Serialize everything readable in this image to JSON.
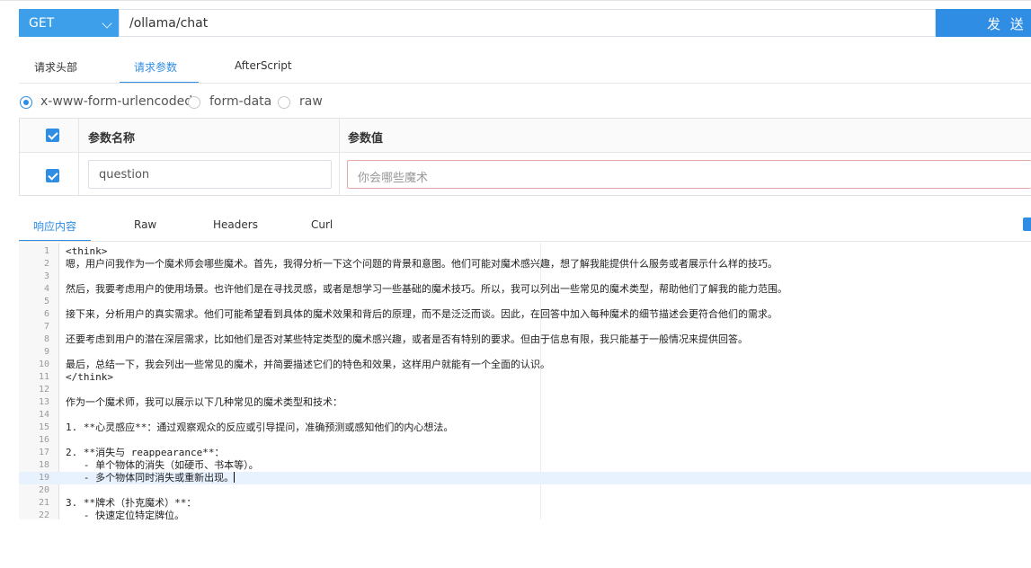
{
  "request": {
    "method": "GET",
    "url": "/ollama/chat",
    "send_label": "发 送"
  },
  "request_tabs": [
    {
      "label": "请求头部",
      "active": false
    },
    {
      "label": "请求参数",
      "active": true
    },
    {
      "label": "AfterScript",
      "active": false
    }
  ],
  "body_types": [
    {
      "label": "x-www-form-urlencoded",
      "selected": true
    },
    {
      "label": "form-data",
      "selected": false
    },
    {
      "label": "raw",
      "selected": false
    }
  ],
  "params": {
    "headers": {
      "name": "参数名称",
      "value": "参数值"
    },
    "rows": [
      {
        "checked": true,
        "name": "question",
        "placeholder": "你会哪些魔术"
      }
    ]
  },
  "response_tabs": [
    {
      "label": "响应内容",
      "active": true
    },
    {
      "label": "Raw",
      "active": false
    },
    {
      "label": "Headers",
      "active": false
    },
    {
      "label": "Curl",
      "active": false
    }
  ],
  "response_lines": [
    "<think>",
    "嗯，用户问我作为一个魔术师会哪些魔术。首先，我得分析一下这个问题的背景和意图。他们可能对魔术感兴趣，想了解我能提供什么服务或者展示什么样的技巧。",
    "",
    "然后，我要考虑用户的使用场景。也许他们是在寻找灵感，或者是想学习一些基础的魔术技巧。所以，我可以列出一些常见的魔术类型，帮助他们了解我的能力范围。",
    "",
    "接下来，分析用户的真实需求。他们可能希望看到具体的魔术效果和背后的原理，而不是泛泛而谈。因此，在回答中加入每种魔术的细节描述会更符合他们的需求。",
    "",
    "还要考虑到用户的潜在深层需求，比如他们是否对某些特定类型的魔术感兴趣，或者是否有特别的要求。但由于信息有限，我只能基于一般情况来提供回答。",
    "",
    "最后，总结一下，我会列出一些常见的魔术，并简要描述它们的特色和效果，这样用户就能有一个全面的认识。",
    "</think>",
    "",
    "作为一个魔术师，我可以展示以下几种常见的魔术类型和技术：",
    "",
    "1. **心灵感应**：通过观察观众的反应或引导提问，准确预测或感知他们的内心想法。",
    "",
    "2. **消失与 reappearance**：",
    "   - 单个物体的消失（如硬币、书本等）。",
    "   - 多个物体同时消失或重新出现。",
    "",
    "3. **牌术（扑克魔术）**：",
    "   - 快速定位特定牌位。"
  ],
  "editor": {
    "current_line": 19
  }
}
